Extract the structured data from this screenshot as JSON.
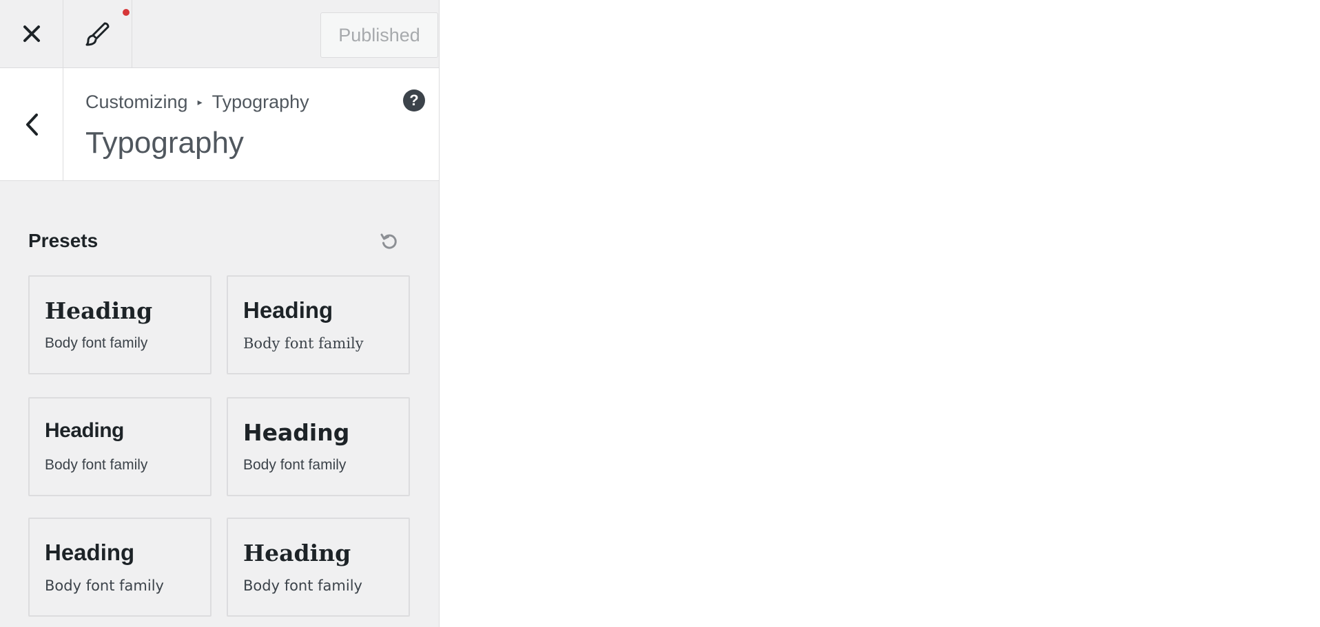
{
  "topbar": {
    "close_icon": "close-icon",
    "brush_icon": "paintbrush-icon",
    "notification_color": "#d63638",
    "publish_label": "Published"
  },
  "section": {
    "back_icon": "chevron-left-icon",
    "breadcrumb_root": "Customizing",
    "breadcrumb_separator": "▸",
    "breadcrumb_current": "Typography",
    "title": "Typography",
    "help_label": "?"
  },
  "presets": {
    "title": "Presets",
    "reset_icon": "reset-icon",
    "items": [
      {
        "heading": "Heading",
        "body": "Body font family"
      },
      {
        "heading": "Heading",
        "body": "Body font family"
      },
      {
        "heading": "Heading",
        "body": "Body font family"
      },
      {
        "heading": "Heading",
        "body": "Body font family"
      },
      {
        "heading": "Heading",
        "body": "Body font family"
      },
      {
        "heading": "Heading",
        "body": "Body font family"
      }
    ]
  }
}
